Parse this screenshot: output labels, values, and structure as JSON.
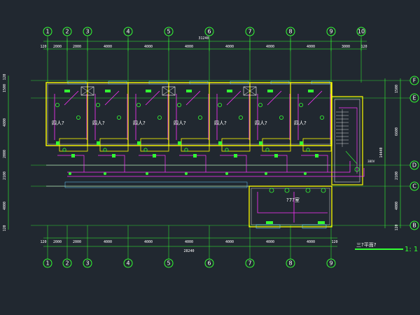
{
  "drawing": {
    "background": "#212830",
    "colors": {
      "grid": "#33ff33",
      "wall": "#ffff00",
      "magenta": "#ff33ff",
      "white": "#ffffff",
      "cyan": "#66ccff"
    },
    "axes_top": [
      "1",
      "2",
      "3",
      "4",
      "5",
      "6",
      "7",
      "8",
      "9",
      "10"
    ],
    "axes_bottom": [
      "1",
      "2",
      "3",
      "4",
      "5",
      "6",
      "7",
      "8",
      "9"
    ],
    "axes_right": [
      "F",
      "E",
      "D",
      "C",
      "B"
    ],
    "top_total": "31240",
    "top_dims": [
      "120",
      "2000",
      "2000",
      "4000",
      "4000",
      "4000",
      "4000",
      "4000",
      "4000",
      "3000",
      "120"
    ],
    "bottom_total": "28240",
    "bottom_dims": [
      "120",
      "2000",
      "2000",
      "4000",
      "4000",
      "4000",
      "4000",
      "4000",
      "4000",
      "120"
    ],
    "left_dims": [
      "120",
      "1500",
      "4800",
      "2000",
      "2100",
      "4000",
      "120"
    ],
    "right_dims": [
      "1500",
      "6600",
      "2100",
      "4000",
      "120"
    ],
    "right_total": "14440",
    "room_labels": [
      "四人?",
      "四人?",
      "四人?",
      "四人?",
      "四人?",
      "四人?",
      "四人?"
    ],
    "office_label": "?7?室",
    "sheet_title": "三?平面?",
    "scale": "1: 1",
    "tag_label": "380V"
  }
}
